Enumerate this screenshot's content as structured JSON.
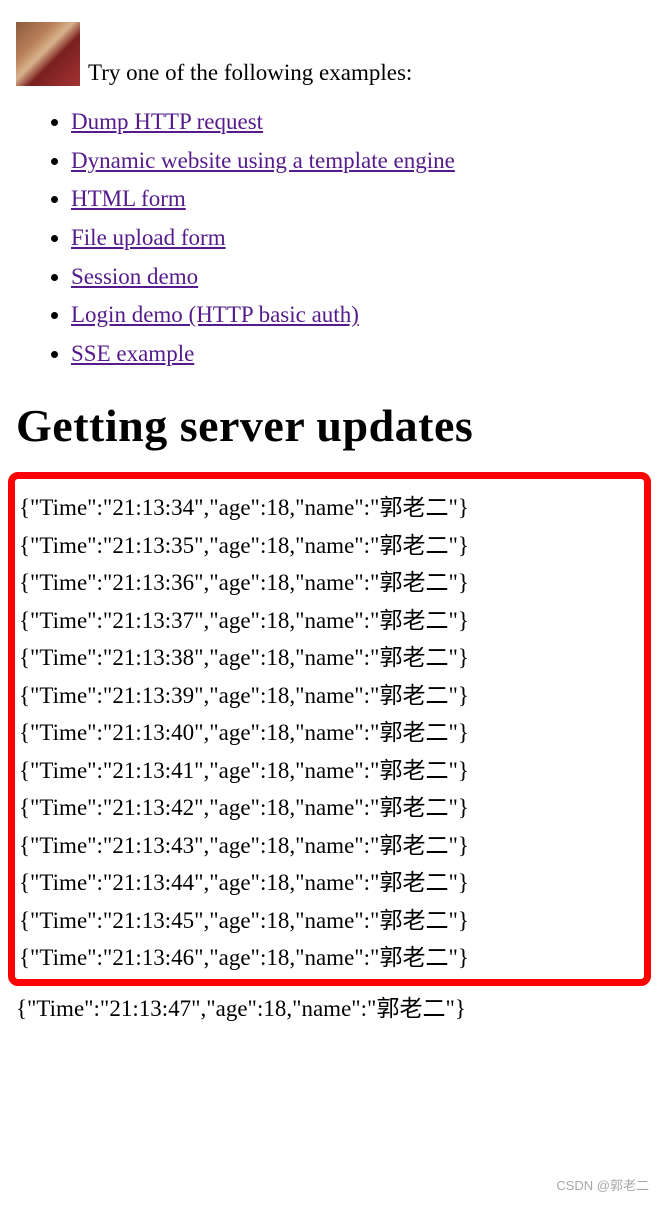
{
  "intro_text": "Try one of the following examples:",
  "examples": {
    "items": [
      "Dump HTTP request",
      "Dynamic website using a template engine",
      "HTML form",
      "File upload form",
      "Session demo",
      "Login demo (HTTP basic auth)",
      "SSE example"
    ]
  },
  "heading": "Getting server updates",
  "updates": {
    "inside_lines": [
      "{\"Time\":\"21:13:34\",\"age\":18,\"name\":\"郭老二\"}",
      "{\"Time\":\"21:13:35\",\"age\":18,\"name\":\"郭老二\"}",
      "{\"Time\":\"21:13:36\",\"age\":18,\"name\":\"郭老二\"}",
      "{\"Time\":\"21:13:37\",\"age\":18,\"name\":\"郭老二\"}",
      "{\"Time\":\"21:13:38\",\"age\":18,\"name\":\"郭老二\"}",
      "{\"Time\":\"21:13:39\",\"age\":18,\"name\":\"郭老二\"}",
      "{\"Time\":\"21:13:40\",\"age\":18,\"name\":\"郭老二\"}",
      "{\"Time\":\"21:13:41\",\"age\":18,\"name\":\"郭老二\"}",
      "{\"Time\":\"21:13:42\",\"age\":18,\"name\":\"郭老二\"}",
      "{\"Time\":\"21:13:43\",\"age\":18,\"name\":\"郭老二\"}",
      "{\"Time\":\"21:13:44\",\"age\":18,\"name\":\"郭老二\"}",
      "{\"Time\":\"21:13:45\",\"age\":18,\"name\":\"郭老二\"}",
      "{\"Time\":\"21:13:46\",\"age\":18,\"name\":\"郭老二\"}"
    ],
    "outside_lines": [
      "{\"Time\":\"21:13:47\",\"age\":18,\"name\":\"郭老二\"}"
    ]
  },
  "watermark": "CSDN @郭老二"
}
